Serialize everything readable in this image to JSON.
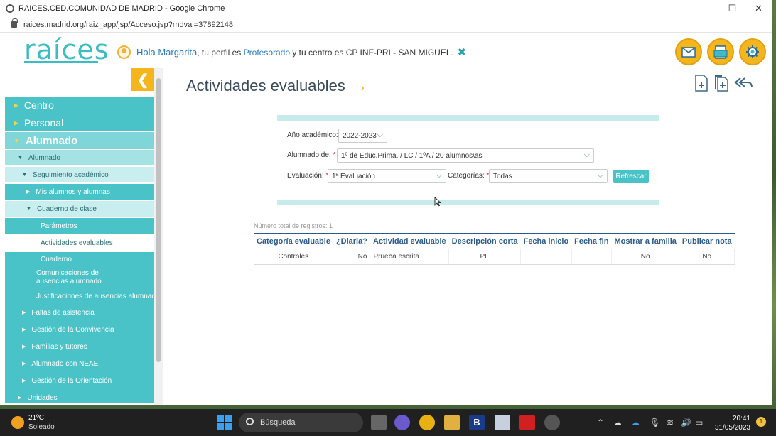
{
  "browser": {
    "window_title": "RAICES.CED.COMUNIDAD DE MADRID - Google Chrome",
    "url": "raices.madrid.org/raiz_app/jsp/Acceso.jsp?rndval=37892148",
    "minimize": "—",
    "maximize": "☐",
    "close": "✕"
  },
  "header": {
    "logo": "raíces",
    "greeting_hola": "Hola Margarita",
    "greeting_mid": ", tu perfil es ",
    "profile": "Profesorado",
    "greeting_end": " y tu centro es CP INF-PRI - SAN MIGUEL.",
    "close_mark": "✖",
    "accent": "#f5b51c",
    "brand": "#3bbdc3"
  },
  "sidebar": {
    "toggle": "❮",
    "items": [
      {
        "label": "Centro"
      },
      {
        "label": "Personal"
      },
      {
        "label": "Alumnado"
      },
      {
        "label": "Alumnado"
      },
      {
        "label": "Seguimiento académico"
      },
      {
        "label": "Mis alumnos y alumnas"
      },
      {
        "label": "Cuaderno de clase"
      },
      {
        "label": "Parámetros"
      },
      {
        "label": "Actividades evaluables"
      },
      {
        "label": "Cuaderno"
      },
      {
        "label": "Comunicaciones de ausencias alumnado"
      },
      {
        "label": "Justificaciones de ausencias alumnado"
      },
      {
        "label": "Faltas de asistencia"
      },
      {
        "label": "Gestión de la Convivencia"
      },
      {
        "label": "Familias y tutores"
      },
      {
        "label": "Alumnado con NEAE"
      },
      {
        "label": "Gestión de la Orientación"
      },
      {
        "label": "Unidades"
      }
    ]
  },
  "main": {
    "title": "Actividades evaluables",
    "title_arrow": "›",
    "form": {
      "anio_label": "Año académico:",
      "anio_value": "2022-2023",
      "alumnado_label": "Alumnado de:",
      "alumnado_value": "1º de Educ.Prima. / LC / 1ºA / 20 alumnos\\as",
      "evaluacion_label": "Evaluación:",
      "evaluacion_value": "1ª Evaluación",
      "categorias_label": "Categorías:",
      "categorias_value": "Todas",
      "required_mark": "*",
      "refresh": "Refrescar"
    },
    "count": "Número total de registros: 1",
    "table": {
      "headers": [
        "Categoría evaluable",
        "¿Diaria?",
        "Actividad evaluable",
        "Descripción corta",
        "Fecha inicio",
        "Fecha fin",
        "Mostrar a familia",
        "Publicar nota"
      ],
      "rows": [
        [
          "Controles",
          "No",
          "Prueba escrita",
          "PE",
          "",
          "",
          "No",
          "No"
        ]
      ]
    }
  },
  "taskbar": {
    "temp": "21ºC",
    "weather": "Soleado",
    "search_placeholder": "Búsqueda",
    "time": "20:41",
    "date": "31/05/2023",
    "notifications": "1"
  }
}
